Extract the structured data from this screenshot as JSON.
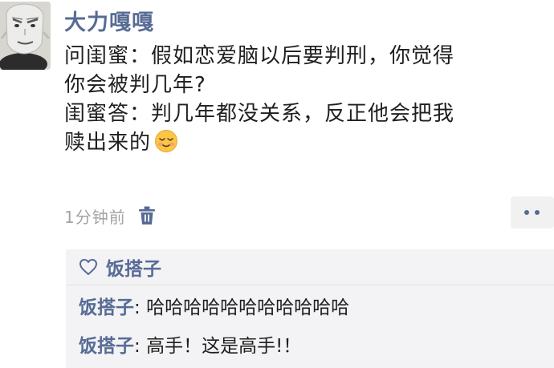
{
  "post": {
    "author": "大力嘎嘎",
    "lines": [
      "问闺蜜：假如恋爱脑以后要判刑，你觉得",
      "你会被判几年?",
      "闺蜜答：判几年都没关系，反正他会把我",
      "赎出来的"
    ],
    "emoji": "smiling-face-emoji",
    "time": "1分钟前"
  },
  "likes": {
    "names": [
      "饭搭子"
    ]
  },
  "comments": [
    {
      "name": "饭搭子",
      "separator": ":",
      "text": "哈哈哈哈哈哈哈哈哈哈哈"
    },
    {
      "name": "饭搭子",
      "separator": ":",
      "text": "高手！这是高手!！"
    }
  ],
  "colors": {
    "link": "#576b95",
    "time": "#a3a3a3",
    "comment_bg": "#f3f3f5"
  }
}
